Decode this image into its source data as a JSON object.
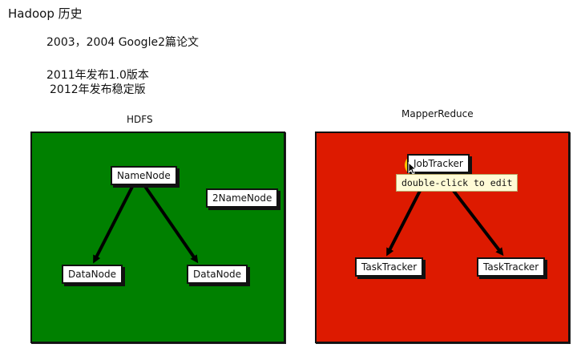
{
  "header": {
    "title": "Hadoop 历史"
  },
  "notes": {
    "line1": "2003，2004 Google2篇论文",
    "line2": "2011年发布1.0版本",
    "line3": "2012年发布稳定版"
  },
  "hdfs": {
    "label": "HDFS",
    "color": "#008000",
    "namenode": "NameNode",
    "secondary": "2NameNode",
    "datanode_left": "DataNode",
    "datanode_right": "DataNode"
  },
  "mapreduce": {
    "label": "MapperReduce",
    "color": "#dd1a00",
    "jobtracker": "JobTracker",
    "tasktracker_left": "TaskTracker",
    "tasktracker_right": "TaskTracker"
  },
  "tooltip": {
    "text": "double-click to edit"
  }
}
